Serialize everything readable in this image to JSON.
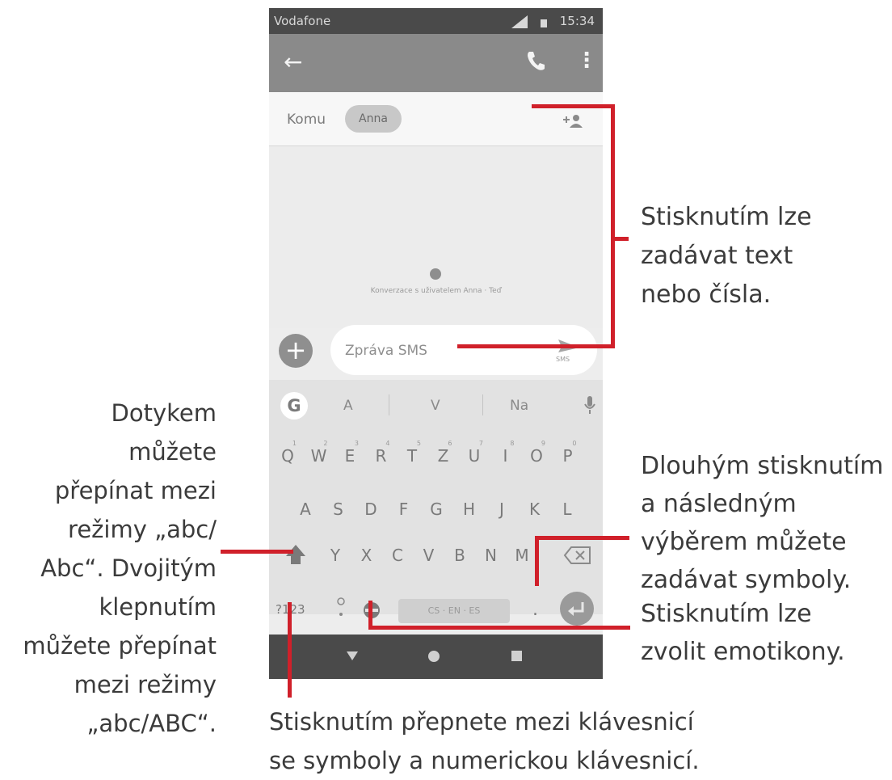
{
  "status_bar": {
    "carrier": "Vodafone",
    "time": "15:34"
  },
  "recipient": {
    "to_label": "Komu",
    "chip": "Anna"
  },
  "conversation": {
    "info": "Konverzace s uživatelem Anna · Teď"
  },
  "compose": {
    "placeholder": "Zpráva SMS",
    "send_label": "SMS"
  },
  "keyboard": {
    "suggestions": [
      "A",
      "V",
      "Na"
    ],
    "g_label": "G",
    "row1": [
      {
        "k": "Q",
        "h": "1"
      },
      {
        "k": "W",
        "h": "2"
      },
      {
        "k": "E",
        "h": "3"
      },
      {
        "k": "R",
        "h": "4"
      },
      {
        "k": "T",
        "h": "5"
      },
      {
        "k": "Z",
        "h": "6"
      },
      {
        "k": "U",
        "h": "7"
      },
      {
        "k": "I",
        "h": "8"
      },
      {
        "k": "O",
        "h": "9"
      },
      {
        "k": "P",
        "h": "0"
      }
    ],
    "row2": [
      "A",
      "S",
      "D",
      "F",
      "G",
      "H",
      "J",
      "K",
      "L"
    ],
    "row3": [
      "Y",
      "X",
      "C",
      "V",
      "B",
      "N",
      "M"
    ],
    "numeric_label": "?123",
    "space_label": "CS · EN · ES",
    "period": "."
  },
  "callouts": {
    "text_input": [
      "Stisknutím lze",
      "zadávat text",
      "nebo čísla."
    ],
    "case_switch": [
      "Dotykem",
      "můžete",
      "přepínat mezi",
      "režimy „abc/",
      "Abc“. Dvojitým",
      "klepnutím",
      "můžete přepínat",
      "mezi režimy",
      "„abc/ABC“."
    ],
    "symbols": [
      "Dlouhým stisknutím",
      "a následným",
      "výběrem můžete",
      "zadávat symboly."
    ],
    "emoji": [
      "Stisknutím lze",
      "zvolit emotikony."
    ],
    "numeric": [
      "Stisknutím přepnete mezi klávesnicí",
      "se symboly a numerickou klávesnicí."
    ]
  },
  "colors": {
    "callout_line": "#d0202a",
    "app_bar": "#8a8a8a",
    "status_bar": "#4a4a4a"
  }
}
